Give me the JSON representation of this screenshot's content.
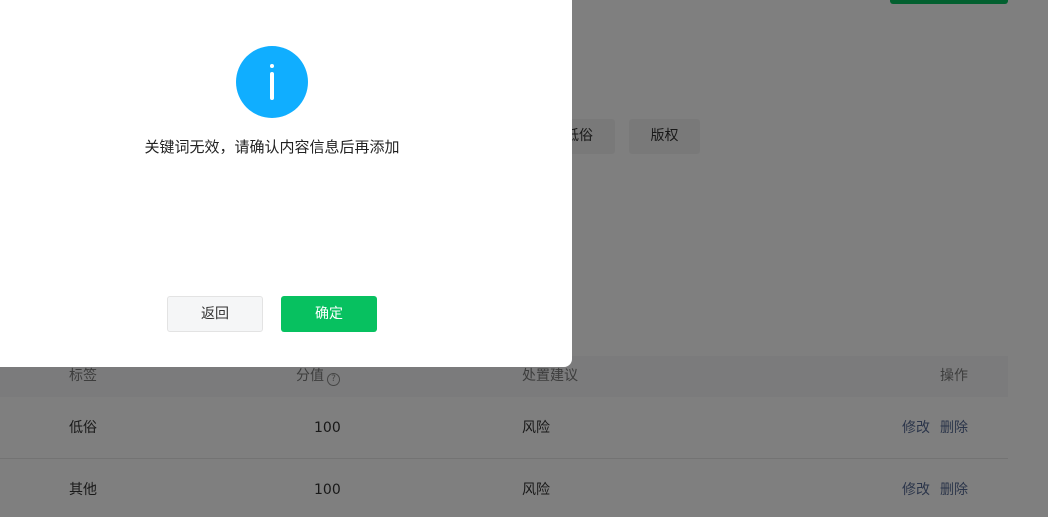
{
  "filters": {
    "chips": [
      "低俗",
      "版权"
    ]
  },
  "table": {
    "headers": {
      "tag": "标签",
      "score": "分值",
      "suggestion": "处置建议",
      "action": "操作"
    },
    "help_icon_glyph": "?",
    "rows": [
      {
        "tag": "低俗",
        "score": "100",
        "suggestion": "风险",
        "edit": "修改",
        "delete": "删除"
      },
      {
        "tag": "其他",
        "score": "100",
        "suggestion": "风险",
        "edit": "修改",
        "delete": "删除"
      }
    ]
  },
  "dialog": {
    "icon": "info-icon",
    "message": "关键词无效，请确认内容信息后再添加",
    "back_label": "返回",
    "confirm_label": "确定"
  },
  "colors": {
    "primary_green": "#07c160",
    "info_blue": "#10aeff",
    "link": "#576b95"
  }
}
